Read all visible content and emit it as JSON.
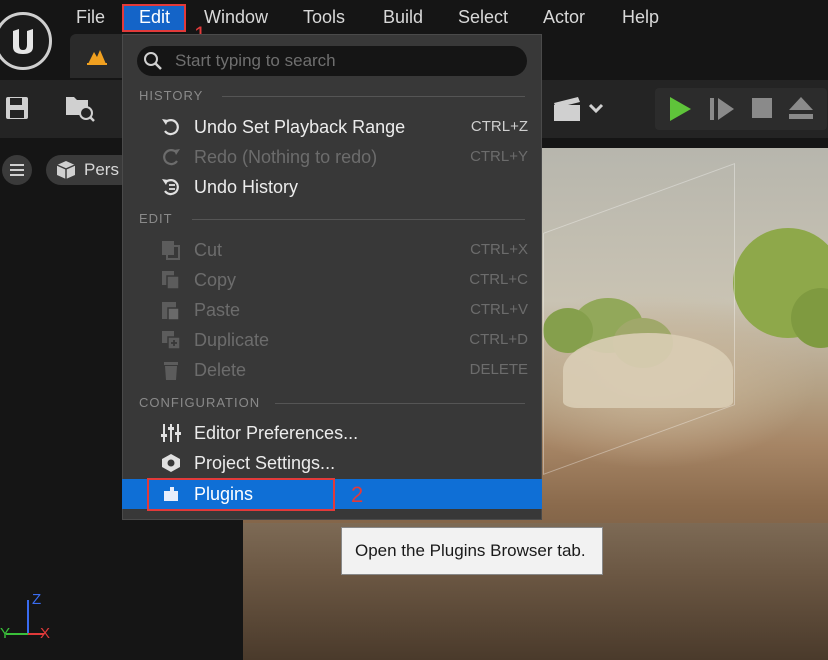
{
  "menubar": {
    "items": [
      "File",
      "Edit",
      "Window",
      "Tools",
      "Build",
      "Select",
      "Actor",
      "Help"
    ],
    "active": "Edit"
  },
  "viewport": {
    "mode_label": "Pers"
  },
  "dropdown": {
    "search_placeholder": "Start typing to search",
    "sections": [
      {
        "label": "HISTORY",
        "items": [
          {
            "label": "Undo Set Playback Range",
            "shortcut": "CTRL+Z",
            "icon": "undo-icon",
            "enabled": true
          },
          {
            "label": "Redo (Nothing to redo)",
            "shortcut": "CTRL+Y",
            "icon": "redo-icon",
            "enabled": false
          },
          {
            "label": "Undo History",
            "shortcut": "",
            "icon": "undo-history-icon",
            "enabled": true
          }
        ]
      },
      {
        "label": "EDIT",
        "items": [
          {
            "label": "Cut",
            "shortcut": "CTRL+X",
            "icon": "cut-icon",
            "enabled": false
          },
          {
            "label": "Copy",
            "shortcut": "CTRL+C",
            "icon": "copy-icon",
            "enabled": false
          },
          {
            "label": "Paste",
            "shortcut": "CTRL+V",
            "icon": "paste-icon",
            "enabled": false
          },
          {
            "label": "Duplicate",
            "shortcut": "CTRL+D",
            "icon": "duplicate-icon",
            "enabled": false
          },
          {
            "label": "Delete",
            "shortcut": "DELETE",
            "icon": "trash-icon",
            "enabled": false
          }
        ]
      },
      {
        "label": "CONFIGURATION",
        "items": [
          {
            "label": "Editor Preferences...",
            "shortcut": "",
            "icon": "sliders-icon",
            "enabled": true
          },
          {
            "label": "Project Settings...",
            "shortcut": "",
            "icon": "project-settings-icon",
            "enabled": true
          },
          {
            "label": "Plugins",
            "shortcut": "",
            "icon": "plugin-icon",
            "enabled": true,
            "highlighted": true
          }
        ]
      }
    ]
  },
  "annotations": {
    "step1": "1",
    "step2": "2",
    "color": "#e23a3a"
  },
  "tooltip": {
    "text": "Open the Plugins Browser tab."
  },
  "axes": {
    "x": "X",
    "y": "Y",
    "z": "Z"
  },
  "colors": {
    "accent": "#0f6fd6",
    "play_green": "#5fc43a",
    "menu_bg": "#383838"
  }
}
